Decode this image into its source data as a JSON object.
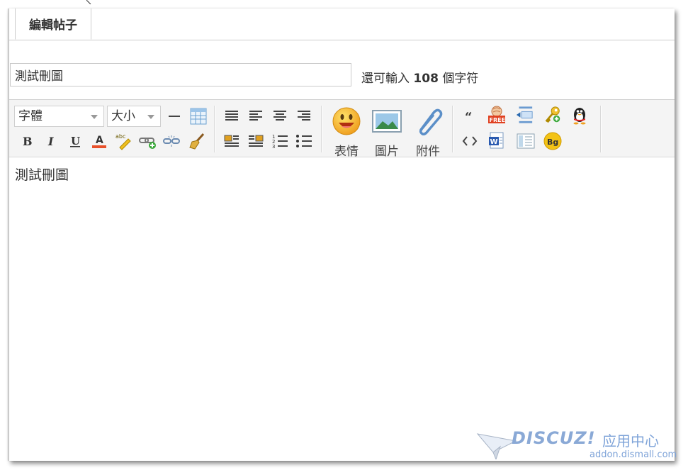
{
  "tab": {
    "label": "編輯帖子"
  },
  "subject": {
    "value": "測試刪圖"
  },
  "counter": {
    "prefix": "還可輸入",
    "count": "108",
    "suffix": "個字符"
  },
  "toolbar": {
    "font_select": "字體",
    "size_select": "大小",
    "emoji_label": "表情",
    "image_label": "圖片",
    "attach_label": "附件",
    "bg_label": "Bg",
    "free_label": "FREE"
  },
  "content": {
    "text": "測試刪圖"
  },
  "watermark": {
    "logo": "DISCUZ!",
    "cn": "应用中心",
    "url": "addon.dismall.com"
  }
}
